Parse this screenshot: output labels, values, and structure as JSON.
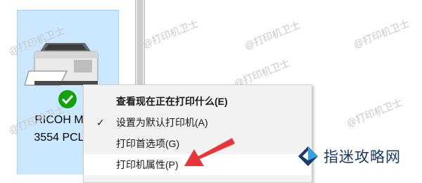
{
  "device": {
    "name_line1": "RICOH M",
    "name_line2": "3554 PCL"
  },
  "context_menu": {
    "items": [
      {
        "label": "查看现在正在打印什么(E)",
        "bold": true,
        "checked": false
      },
      {
        "label": "设置为默认打印机(A)",
        "bold": false,
        "checked": true
      },
      {
        "label": "打印首选项(G)",
        "bold": false,
        "checked": false
      },
      {
        "label": "打印机属性(P)",
        "bold": false,
        "checked": false
      }
    ],
    "checkmark": "✓"
  },
  "watermarks": [
    "@打印机卫士",
    "@打印机卫士",
    "@打印机卫士",
    "@打印机卫士",
    "@打印机卫士",
    "@打印机卫士",
    "@打印机卫士",
    "@打印机卫士",
    "@打印机卫士"
  ],
  "logo": {
    "text": "指迷攻略网"
  },
  "colors": {
    "selection_bg": "#cce8ff",
    "menu_bg": "#f2f2f2",
    "arrow": "#e8353a",
    "check_badge": "#13a10e"
  }
}
